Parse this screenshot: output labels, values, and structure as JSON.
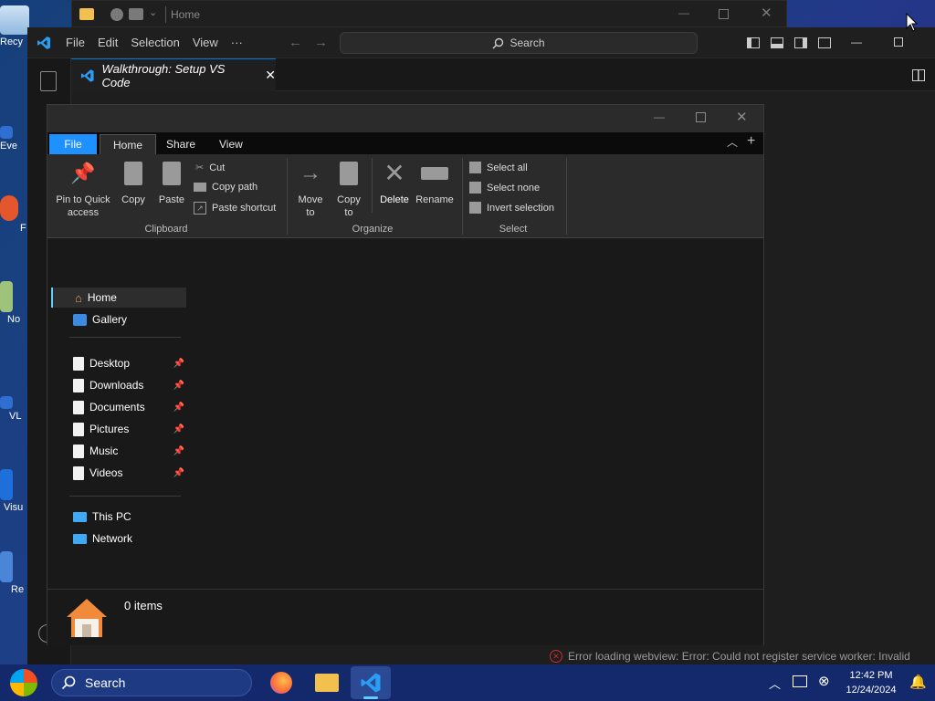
{
  "desktop": {
    "icons": [
      {
        "label": "Recy"
      },
      {
        "label": "Eve"
      },
      {
        "label": "F"
      },
      {
        "label": "No"
      },
      {
        "label": "VL"
      },
      {
        "label": "Visu"
      },
      {
        "label": "Re"
      }
    ]
  },
  "bg_explorer": {
    "breadcrumb": "Home"
  },
  "vscode": {
    "menu": [
      "File",
      "Edit",
      "Selection",
      "View",
      "···"
    ],
    "search_label": "Search",
    "tab_label": "Walkthrough: Setup VS Code",
    "error_message": "Error loading webview: Error: Could not register service worker: Invalid"
  },
  "explorer": {
    "ribbon_tabs": [
      "File",
      "Home",
      "Share",
      "View"
    ],
    "clipboard": {
      "pin_label_1": "Pin to Quick",
      "pin_label_2": "access",
      "copy": "Copy",
      "paste": "Paste",
      "cut": "Cut",
      "copy_path": "Copy path",
      "paste_shortcut": "Paste shortcut",
      "group": "Clipboard"
    },
    "organize": {
      "move_1": "Move",
      "move_2": "to",
      "copy_1": "Copy",
      "copy_2": "to",
      "delete": "Delete",
      "rename": "Rename",
      "group": "Organize"
    },
    "select": {
      "select_all": "Select all",
      "select_none": "Select none",
      "invert": "Invert selection",
      "group": "Select"
    },
    "nav": {
      "home": "Home",
      "gallery": "Gallery",
      "quick": [
        "Desktop",
        "Downloads",
        "Documents",
        "Pictures",
        "Music",
        "Videos"
      ],
      "this_pc": "This PC",
      "network": "Network"
    },
    "status": {
      "items": "0 items"
    }
  },
  "taskbar": {
    "search": "Search",
    "time": "12:42 PM",
    "date": "12/24/2024"
  },
  "colors": {
    "accent": "#0078d4",
    "file_tab": "#1e90ff",
    "error": "#c72e2e"
  }
}
